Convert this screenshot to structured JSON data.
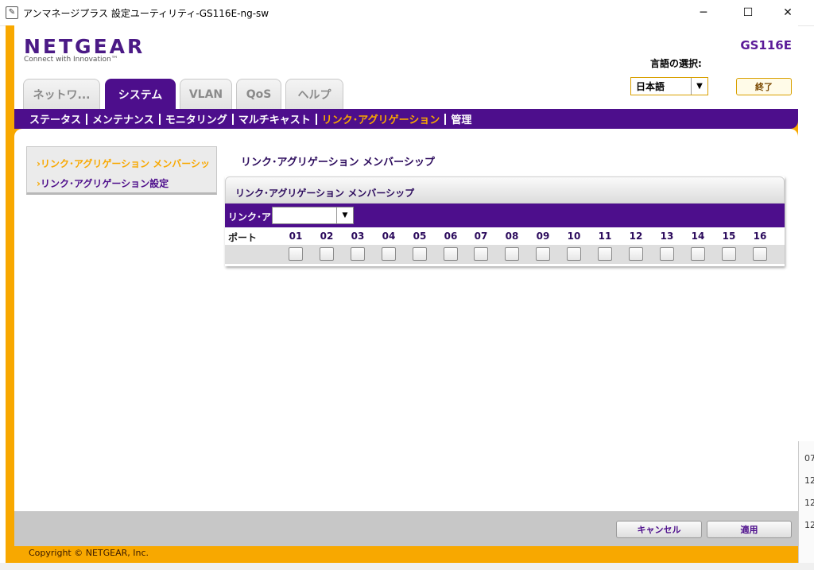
{
  "window": {
    "title": "アンマネージプラス 設定ユーティリティ-GS116E-ng-sw",
    "minimize": "─",
    "maximize": "☐",
    "close": "✕"
  },
  "header": {
    "logo": "NETGEAR",
    "tagline": "Connect with Innovation™",
    "model": "GS116E",
    "language_label": "言語の選択:",
    "language_value": "日本語",
    "logout_label": "終了"
  },
  "tabs": [
    {
      "label": "ネットワ...",
      "active": false
    },
    {
      "label": "システム",
      "active": true
    },
    {
      "label": "VLAN",
      "active": false
    },
    {
      "label": "QoS",
      "active": false
    },
    {
      "label": "ヘルプ",
      "active": false
    }
  ],
  "submenu": [
    {
      "label": "ステータス"
    },
    {
      "label": "メンテナンス"
    },
    {
      "label": "モニタリング"
    },
    {
      "label": "マルチキャスト"
    },
    {
      "label": "リンク･アグリゲーション",
      "current": true
    },
    {
      "label": "管理"
    }
  ],
  "left_nav": [
    {
      "label": "リンク･アグリゲーション メンバーシッ",
      "active": true
    },
    {
      "label": "リンク･アグリゲーション設定",
      "active": false
    }
  ],
  "page_title": "リンク･アグリゲーション メンバーシップ",
  "panel": {
    "title": "リンク･アグリゲーション メンバーシップ",
    "lag_label": "リンク･ア",
    "lag_value": "",
    "port_label": "ポート",
    "ports": [
      "01",
      "02",
      "03",
      "04",
      "05",
      "06",
      "07",
      "08",
      "09",
      "10",
      "11",
      "12",
      "13",
      "14",
      "15",
      "16"
    ]
  },
  "footer": {
    "cancel_label": "キャンセル",
    "apply_label": "適用",
    "copyright": "Copyright © NETGEAR, Inc."
  },
  "background": {
    "partial_numbers": [
      "07",
      "12",
      "12",
      "12"
    ]
  },
  "colors": {
    "brand_purple": "#4d0e8c",
    "accent_orange": "#f8a800"
  }
}
